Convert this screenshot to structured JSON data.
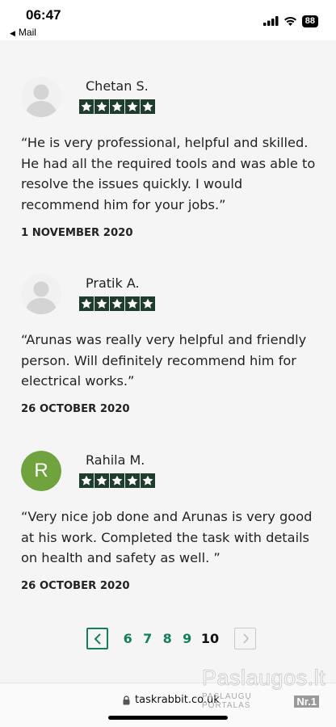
{
  "status_bar": {
    "time": "06:47",
    "back_label": "Mail",
    "battery": "88"
  },
  "reviews": [
    {
      "name": "Chetan S.",
      "rating": 5,
      "text": "“He is very professional, helpful and skilled. He had all the required tools and was able to resolve the issues quickly. I would recommend him for your jobs.”",
      "date": "1 NOVEMBER 2020",
      "avatar": "person-placeholder-icon"
    },
    {
      "name": "Pratik A.",
      "rating": 5,
      "text": "“Arunas was really very helpful and friendly person. Will definitely recommend him for electrical works.”",
      "date": "26 OCTOBER 2020",
      "avatar": "person-placeholder-icon"
    },
    {
      "name": "Rahila M.",
      "rating": 5,
      "text": "“Very nice job done and Arunas is very good at his work. Completed the task with details on health and safety as well. ”",
      "date": "26 OCTOBER 2020",
      "avatar_letter": "R"
    }
  ],
  "pagination": {
    "pages": [
      "6",
      "7",
      "8",
      "9",
      "10"
    ],
    "current": "10"
  },
  "browser": {
    "url": "taskrabbit.co.uk"
  },
  "watermark": {
    "title": "Paslaugos.lt",
    "subtitle": "PASLAUGŲ PORTALAS",
    "badge": "Nr.1"
  },
  "colors": {
    "accent": "#137f5b",
    "star_bg": "#1e3d2c",
    "avatar_green": "#6fa33e"
  }
}
